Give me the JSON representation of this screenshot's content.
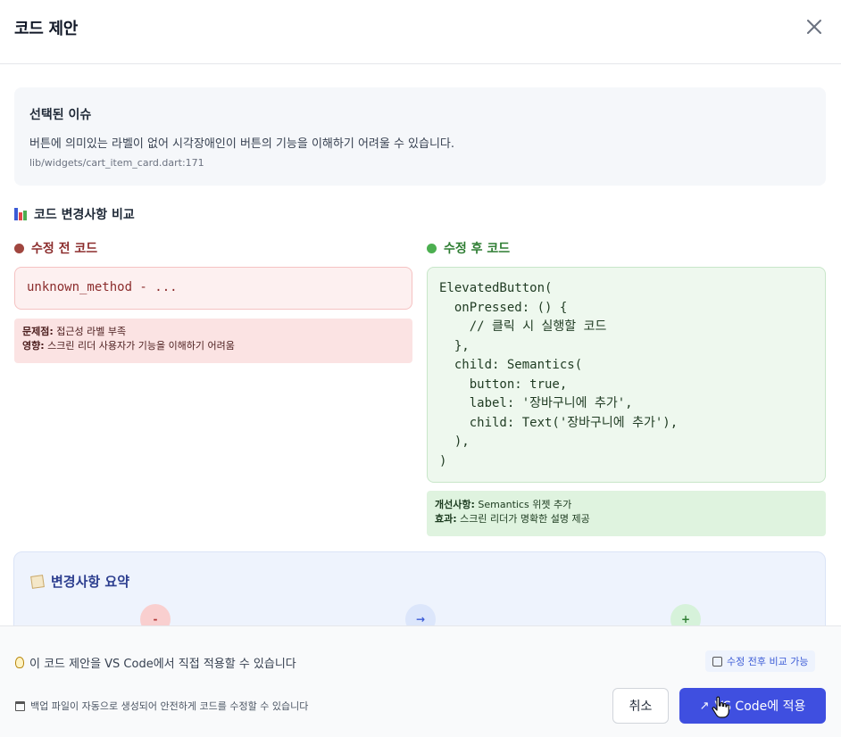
{
  "dialog": {
    "title": "코드 제안"
  },
  "issue": {
    "heading": "선택된 이슈",
    "description": "버튼에 의미있는 라벨이 없어 시각장애인이 버튼의 기능을 이해하기 어려울 수 있습니다.",
    "location": "lib/widgets/cart_item_card.dart:171"
  },
  "compare": {
    "heading": "코드 변경사항 비교",
    "before": {
      "label": "수정 전 코드",
      "code": "unknown_method - ...",
      "problem_label": "문제점:",
      "problem_text": " 접근성 라벨 부족",
      "impact_label": "영향:",
      "impact_text": " 스크린 리더 사용자가 기능을 이해하기 어려움"
    },
    "after": {
      "label": "수정 후 코드",
      "code": "ElevatedButton(\n  onPressed: () {\n    // 클릭 시 실행할 코드\n  },\n  child: Semantics(\n    button: true,\n    label: '장바구니에 추가',\n    child: Text('장바구니에 추가'),\n  ),\n)",
      "improvement_label": "개선사항:",
      "improvement_text": " Semantics 위젯 추가",
      "effect_label": "효과:",
      "effect_text": " 스크린 리더가 명확한 설명 제공"
    }
  },
  "summary": {
    "heading": "변경사항 요약",
    "steps": [
      "-",
      "→",
      "+"
    ]
  },
  "footer": {
    "info": "이 코드 제안을 VS Code에서 직접 적용할 수 있습니다",
    "compare_badge": "수정 전후 비교 가능",
    "backup_note": "백업 파일이 자동으로 생성되어 안전하게 코드를 수정할 수 있습니다",
    "cancel_label": "취소",
    "apply_label": "VS Code에 적용"
  },
  "colors": {
    "before_dot": "#a0463f",
    "after_dot": "#4caf50",
    "apply_button": "#3f4fe0",
    "summary_bg": "#eef3fd"
  },
  "icons": {
    "close": "close-icon",
    "chart": "bar-chart-icon",
    "memo": "memo-icon",
    "bulb": "lightbulb-icon",
    "refresh": "refresh-icon",
    "calendar": "calendar-icon",
    "rocket": "rocket-icon",
    "cursor": "hand-pointer-icon"
  }
}
